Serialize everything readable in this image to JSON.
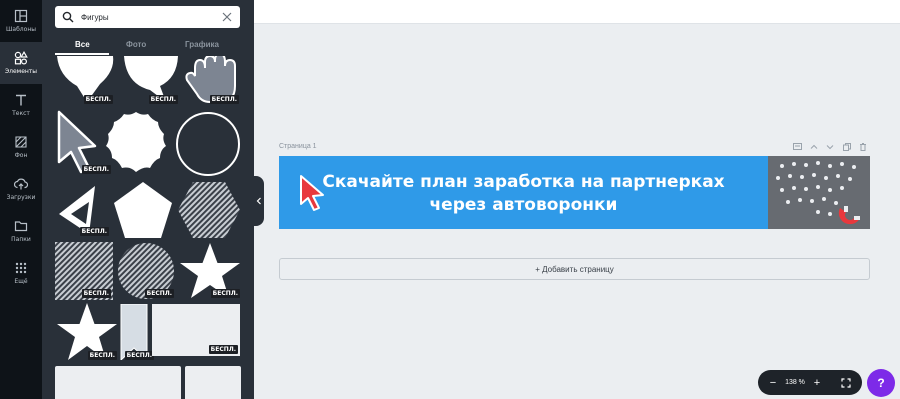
{
  "rail": {
    "items": [
      {
        "label": "Шаблоны",
        "icon": "templates-icon"
      },
      {
        "label": "Элементы",
        "icon": "elements-icon"
      },
      {
        "label": "Текст",
        "icon": "text-icon"
      },
      {
        "label": "Фон",
        "icon": "background-icon"
      },
      {
        "label": "Загрузки",
        "icon": "upload-icon"
      },
      {
        "label": "Папки",
        "icon": "folder-icon"
      },
      {
        "label": "Ещё",
        "icon": "more-icon"
      }
    ],
    "active_index": 1
  },
  "panel": {
    "search_value": "Фигуры",
    "tabs": [
      "Все",
      "Фото",
      "Графика"
    ],
    "active_tab": 0,
    "badge_label": "БЕСПЛ."
  },
  "canvas": {
    "page_label": "Страница 1",
    "banner_text_line1": "Скачайте план заработка на партнерках",
    "banner_text_line2": "через автоворонки",
    "add_page_label": "+ Добавить страницу"
  },
  "zoom": {
    "minus": "−",
    "value": "138 %",
    "plus": "+"
  },
  "help_label": "?",
  "colors": {
    "rail_bg": "#0e1318",
    "panel_bg": "#293039",
    "banner_bg": "#2f9ae8",
    "help_bg": "#7d2ae8",
    "cursor_red": "#e8383d"
  }
}
